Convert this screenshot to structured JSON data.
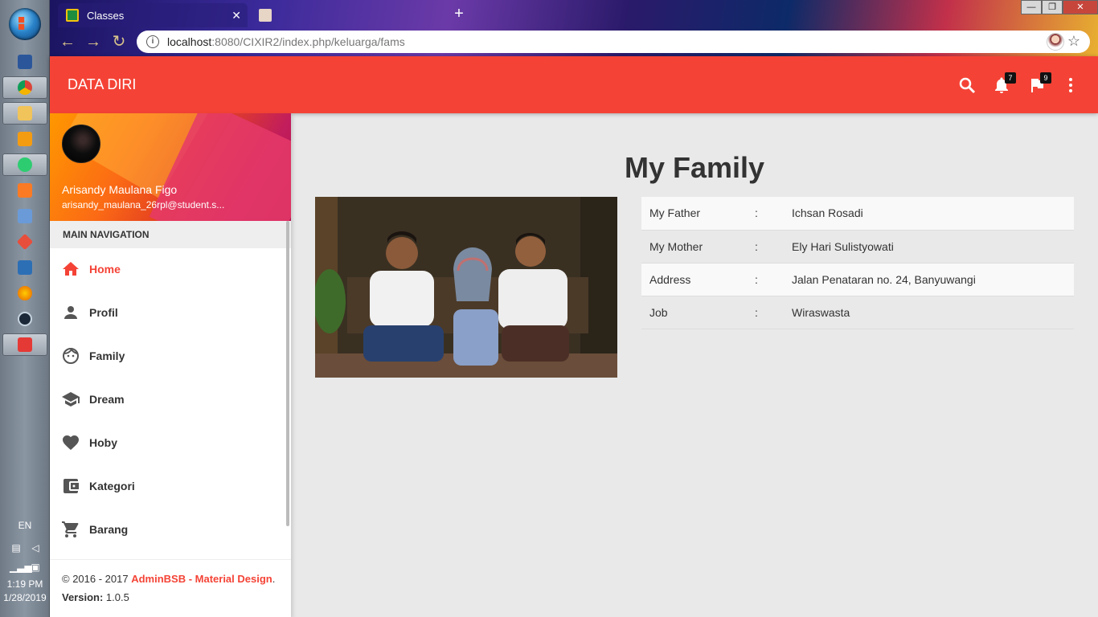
{
  "system": {
    "language": "EN",
    "time": "1:19 PM",
    "date": "1/28/2019"
  },
  "browser": {
    "tabs": [
      {
        "title": "Classes",
        "active": true
      },
      {
        "title": "",
        "active": false
      }
    ],
    "url_host": "localhost",
    "url_path": ":8080/CIXIR2/index.php/keluarga/fams",
    "icons": [
      "back-icon",
      "reload-icon",
      "info-icon",
      "star-icon",
      "menu-dots-icon"
    ]
  },
  "topbar": {
    "brand": "DATA DIRI",
    "notifications_count": "7",
    "tasks_count": "9",
    "accent_color": "#f44336"
  },
  "sidebar": {
    "user_name": "Arisandy Maulana Figo",
    "user_email": "arisandy_maulana_26rpl@student.s...",
    "nav_header": "MAIN NAVIGATION",
    "items": [
      {
        "label": "Home",
        "icon": "home-icon",
        "active": true
      },
      {
        "label": "Profil",
        "icon": "person-icon",
        "active": false
      },
      {
        "label": "Family",
        "icon": "face-icon",
        "active": false
      },
      {
        "label": "Dream",
        "icon": "school-icon",
        "active": false
      },
      {
        "label": "Hoby",
        "icon": "heart-icon",
        "active": false
      },
      {
        "label": "Kategori",
        "icon": "wallet-icon",
        "active": false
      },
      {
        "label": "Barang",
        "icon": "cart-icon",
        "active": false
      }
    ],
    "footer": {
      "copyright": "© 2016 - 2017 ",
      "brand_link": "AdminBSB - Material Design",
      "period": ".",
      "version_label": "Version:",
      "version_value": " 1.0.5"
    }
  },
  "content": {
    "title": "My Family",
    "rows": [
      {
        "key": "My Father",
        "sep": ":",
        "value": "Ichsan Rosadi"
      },
      {
        "key": "My Mother",
        "sep": ":",
        "value": "Ely Hari Sulistyowati"
      },
      {
        "key": "Address",
        "sep": ":",
        "value": "Jalan Penataran no. 24, Banyuwangi"
      },
      {
        "key": "Job",
        "sep": ":",
        "value": "Wiraswasta"
      }
    ]
  }
}
